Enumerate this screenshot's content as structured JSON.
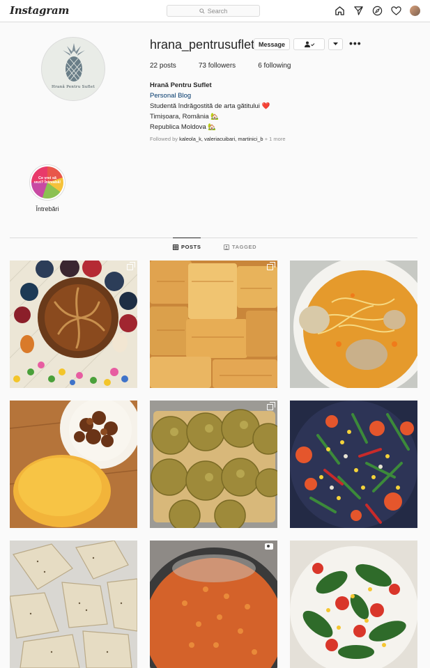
{
  "app": {
    "logo": "Instagram"
  },
  "search": {
    "placeholder": "Search"
  },
  "nav_icons": [
    "home-icon",
    "direct-icon",
    "explore-icon",
    "activity-heart-icon",
    "profile-avatar"
  ],
  "profile": {
    "username": "hrana_pentrusuflet",
    "avatar_text": "Hrană Pentru Suflet",
    "message_label": "Message",
    "stats": {
      "posts": "22",
      "posts_label": "posts",
      "followers": "73",
      "followers_label": "followers",
      "following": "6",
      "following_label": "following"
    },
    "bio": {
      "name": "Hrană Pentru Suflet",
      "category": "Personal Blog",
      "line1": "Studentă îndrăgostită de arta gătitului ❤️",
      "line2": "Timișoara, România 🏡",
      "line3": "Republica Moldova 🏡"
    },
    "followed_by": {
      "prefix": "Followed by",
      "names": "kaleola_k, valeriacuibari, martinici_b",
      "suffix": "+ 1 more"
    }
  },
  "highlights": [
    {
      "label": "Întrebări",
      "cover_text": "Ce vrei să vezi? Întreabă!"
    }
  ],
  "tabs": [
    {
      "label": "POSTS",
      "active": true
    },
    {
      "label": "TAGGED",
      "active": false
    }
  ],
  "posts": [
    {
      "subject": "easter-bread",
      "badge": "multiple"
    },
    {
      "subject": "crepes",
      "badge": "multiple"
    },
    {
      "subject": "chicken-soup",
      "badge": "none"
    },
    {
      "subject": "polenta-stew",
      "badge": "none"
    },
    {
      "subject": "zucchini-fritters",
      "badge": "multiple"
    },
    {
      "subject": "vegetable-stir-fry",
      "badge": "none"
    },
    {
      "subject": "grilled-chicken",
      "badge": "none"
    },
    {
      "subject": "tomato-sauce-pan",
      "badge": "video"
    },
    {
      "subject": "salad",
      "badge": "none"
    }
  ],
  "colors": {
    "link": "#00376b",
    "border": "#dbdbdb",
    "muted": "#8e8e8e",
    "text": "#262626"
  }
}
